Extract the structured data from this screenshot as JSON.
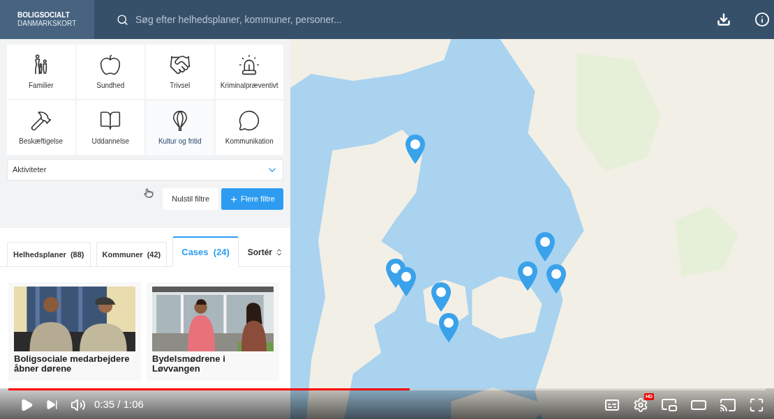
{
  "header": {
    "brand_line1": "BOLIGSOCIALT",
    "brand_line2": "DANMARKSKORT",
    "search_placeholder": "Søg efter helhedsplaner, kommuner, personer..."
  },
  "categories": [
    {
      "label": "Familier",
      "kind": "family",
      "selected": false
    },
    {
      "label": "Sundhed",
      "kind": "apple",
      "selected": false
    },
    {
      "label": "Trivsel",
      "kind": "handshake",
      "selected": false
    },
    {
      "label": "Kriminalpræventivt",
      "kind": "siren",
      "selected": false
    },
    {
      "label": "Beskæftigelse",
      "kind": "hammer",
      "selected": false
    },
    {
      "label": "Uddannelse",
      "kind": "book",
      "selected": false
    },
    {
      "label": "Kultur og fritid",
      "kind": "balloon",
      "selected": true
    },
    {
      "label": "Kommunikation",
      "kind": "speech",
      "selected": false
    }
  ],
  "dropdown": {
    "label": "Aktiviteter"
  },
  "buttons": {
    "reset": "Nulstil filtre",
    "more": "Flere filtre"
  },
  "tabs": [
    {
      "label": "Helhedsplaner",
      "count": "(88)",
      "selected": false
    },
    {
      "label": "Kommuner",
      "count": "(42)",
      "selected": false
    },
    {
      "label": "Cases",
      "count": "(24)",
      "selected": true
    }
  ],
  "sort": {
    "label": "Sortér"
  },
  "cards": [
    {
      "title": "Boligsociale medarbejdere åbner dørene"
    },
    {
      "title": "Bydelsmødrene i Løvvangen"
    }
  ],
  "player": {
    "time": "0:35 / 1:06",
    "level": 0.53,
    "hd_badge": "HD"
  }
}
